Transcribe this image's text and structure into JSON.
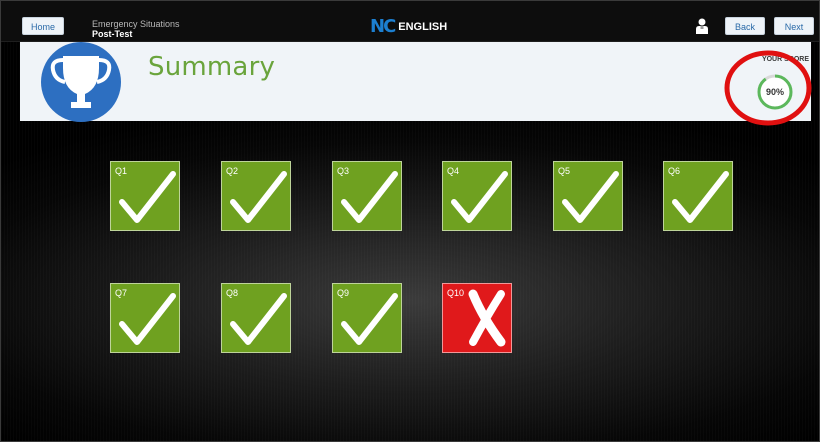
{
  "topbar": {
    "home_label": "Home",
    "lesson_title": "Emergency Situations",
    "lesson_subtitle": "Post-Test",
    "logo_mark": "NC",
    "logo_text": "ENGLISH",
    "back_label": "Back",
    "next_label": "Next",
    "user_icon": "user-icon"
  },
  "summary": {
    "title": "Summary",
    "badge_icon": "trophy-icon",
    "score_label": "YOUR SCORE",
    "score_value": "90%",
    "score_fraction": 0.9
  },
  "colors": {
    "correct": "#6fa120",
    "wrong": "#e0191b",
    "brand_blue": "#2d6fc1",
    "summary_green": "#6aa43c",
    "highlight_red": "#e01010"
  },
  "questions": [
    {
      "label": "Q1",
      "result": "correct"
    },
    {
      "label": "Q2",
      "result": "correct"
    },
    {
      "label": "Q3",
      "result": "correct"
    },
    {
      "label": "Q4",
      "result": "correct"
    },
    {
      "label": "Q5",
      "result": "correct"
    },
    {
      "label": "Q6",
      "result": "correct"
    },
    {
      "label": "Q7",
      "result": "correct"
    },
    {
      "label": "Q8",
      "result": "correct"
    },
    {
      "label": "Q9",
      "result": "correct"
    },
    {
      "label": "Q10",
      "result": "wrong"
    }
  ]
}
